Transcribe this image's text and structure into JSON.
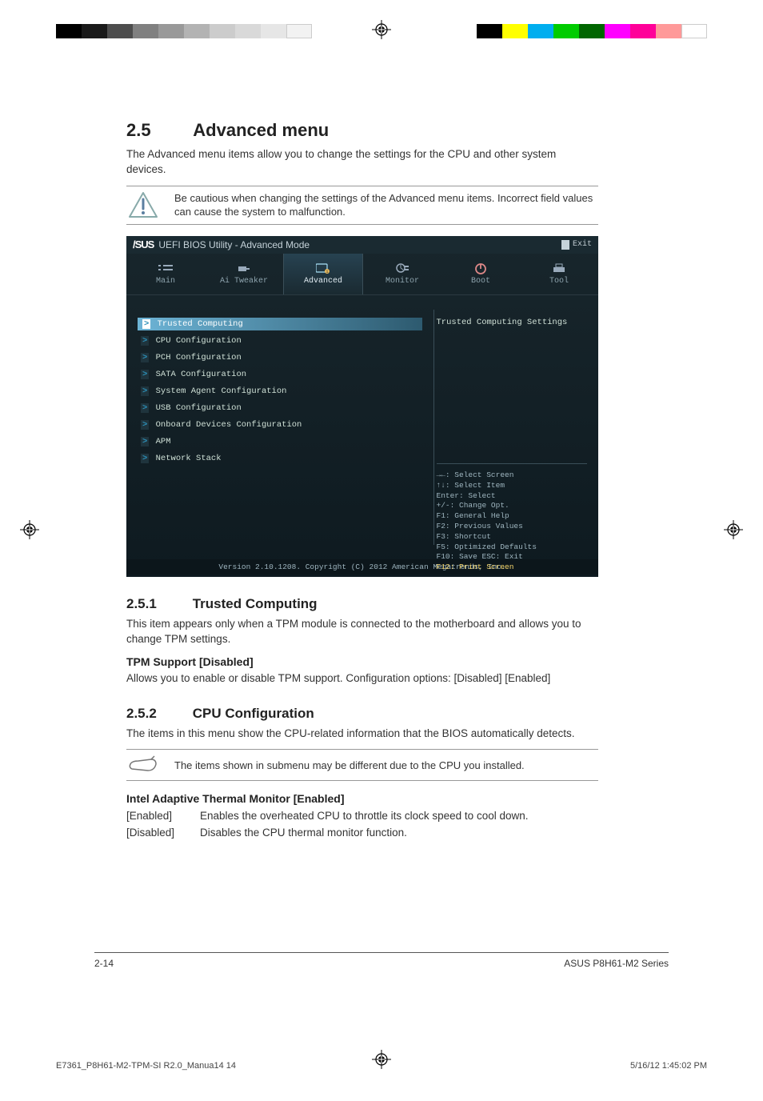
{
  "heading": {
    "num": "2.5",
    "title": "Advanced menu"
  },
  "intro": "The Advanced menu items allow you to change the settings for the CPU and other system devices.",
  "caution": "Be cautious when changing the settings of the Advanced menu items. Incorrect field values can cause the system to malfunction.",
  "bios": {
    "logo": "/SUS",
    "title": "UEFI BIOS Utility - Advanced Mode",
    "exit": "Exit",
    "tabs": [
      "Main",
      "Ai Tweaker",
      "Advanced",
      "Monitor",
      "Boot",
      "Tool"
    ],
    "active_tab": 2,
    "menu": [
      "Trusted Computing",
      "CPU Configuration",
      "PCH Configuration",
      "SATA Configuration",
      "System Agent Configuration",
      "USB Configuration",
      "Onboard Devices Configuration",
      "APM",
      "Network Stack"
    ],
    "selected_menu": 0,
    "help_title": "Trusted Computing Settings",
    "help_keys": [
      "→←: Select Screen",
      "↑↓: Select Item",
      "Enter: Select",
      "+/-: Change Opt.",
      "F1: General Help",
      "F2: Previous Values",
      "F3: Shortcut",
      "F5: Optimized Defaults",
      "F10: Save  ESC: Exit"
    ],
    "help_highlight": "F12: Print Screen",
    "footer": "Version 2.10.1208. Copyright (C) 2012 American Megatrends, Inc."
  },
  "sec251": {
    "num": "2.5.1",
    "title": "Trusted Computing",
    "desc": "This item appears only when a TPM module is connected to the motherboard and allows you to change TPM settings.",
    "item_title": "TPM Support [Disabled]",
    "item_desc": "Allows you to enable or disable TPM support. Configuration options: [Disabled] [Enabled]"
  },
  "sec252": {
    "num": "2.5.2",
    "title": "CPU Configuration",
    "desc": "The items in this menu show the CPU-related information that the BIOS automatically detects.",
    "note": "The items shown in submenu may be different due to the CPU you installed.",
    "item_title": "Intel Adaptive Thermal Monitor [Enabled]",
    "opts": [
      {
        "k": "[Enabled]",
        "v": "Enables the overheated CPU to throttle its clock speed to cool down."
      },
      {
        "k": "[Disabled]",
        "v": "Disables the CPU thermal monitor function."
      }
    ]
  },
  "page_footer": {
    "left": "2-14",
    "right": "ASUS P8H61-M2 Series"
  },
  "job_footer": {
    "left": "E7361_P8H61-M2-TPM-SI R2.0_Manua14   14",
    "right": "5/16/12   1:45:02 PM"
  }
}
